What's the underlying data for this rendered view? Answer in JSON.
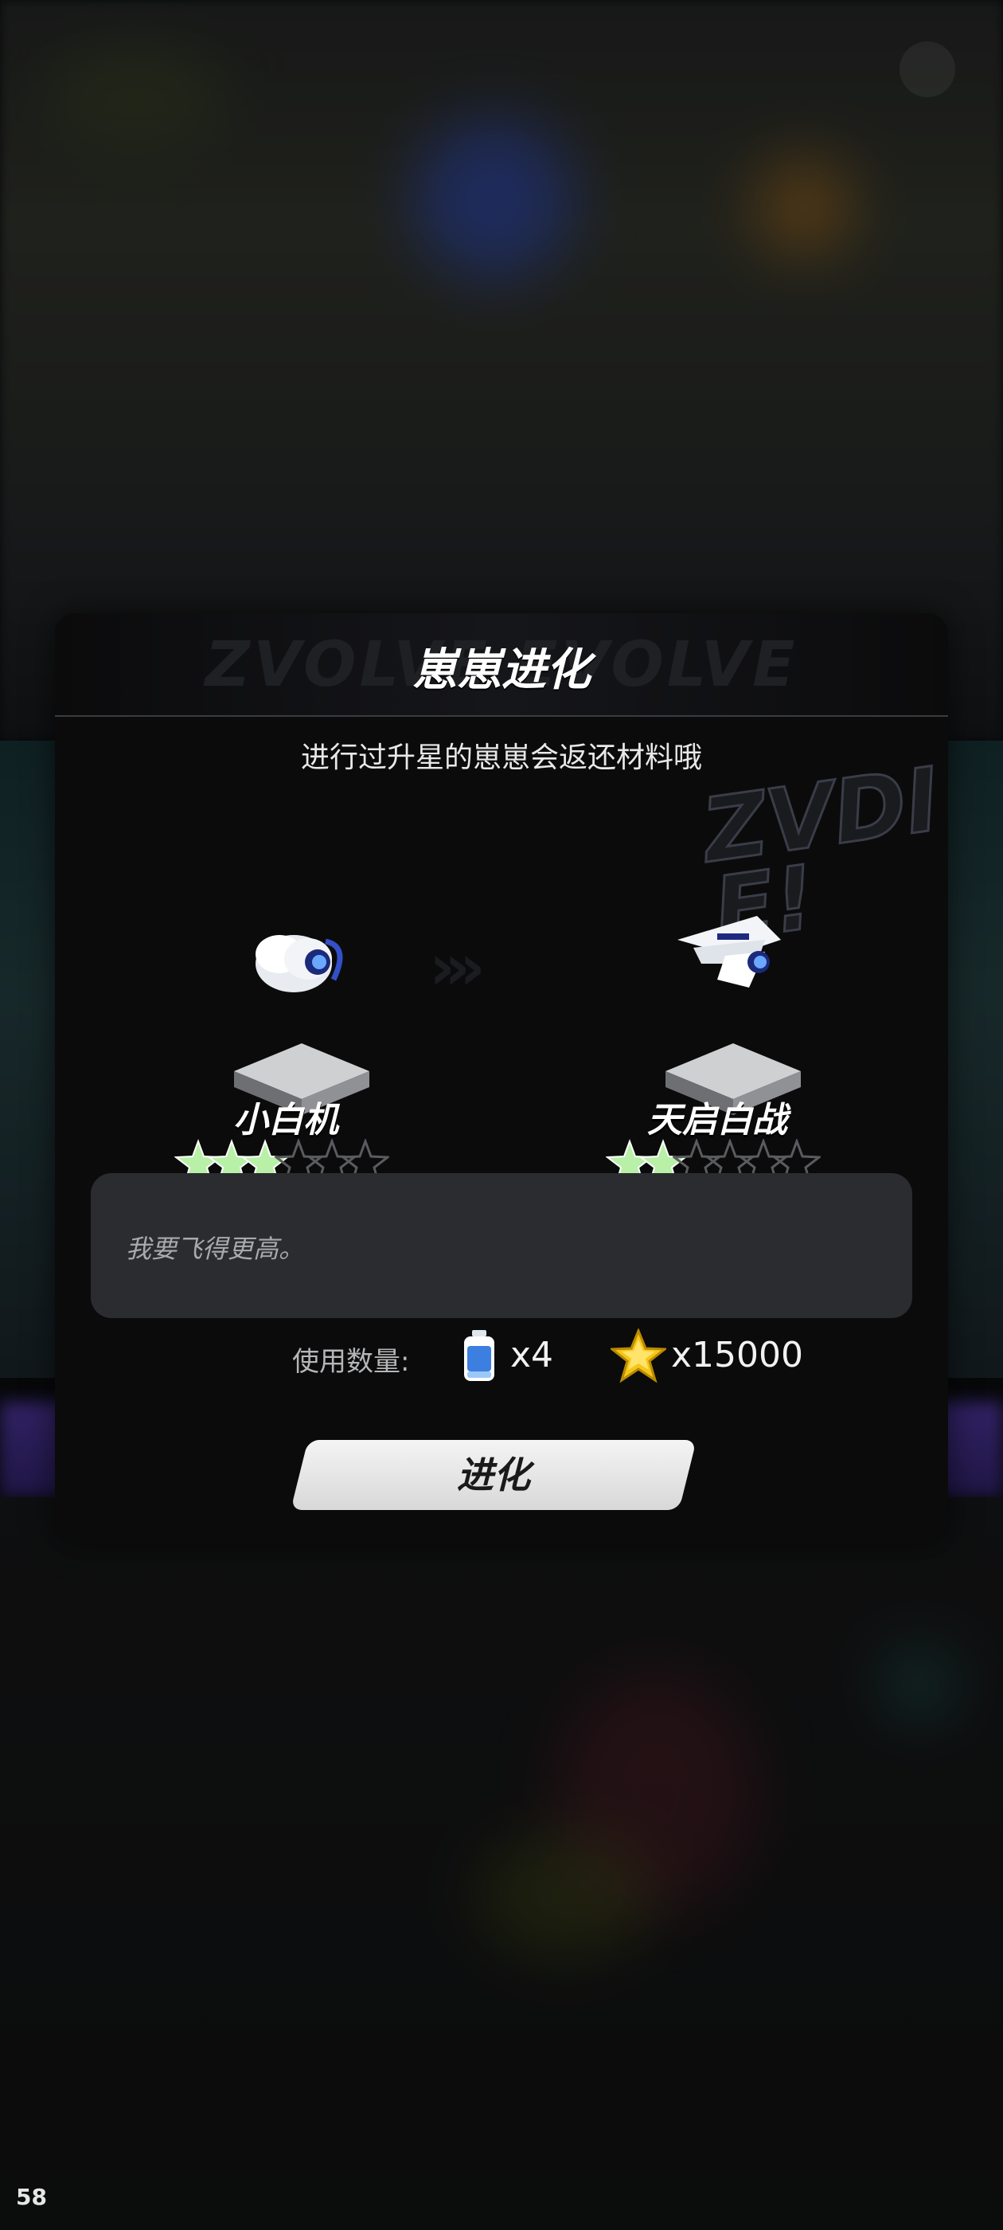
{
  "status": {
    "fps": "58"
  },
  "dialog": {
    "title": "崽崽进化",
    "graffiti": "ZVOLVE EVOLVE",
    "subtitle": "进行过升星的崽崽会返还材料哦",
    "current_pet": {
      "name": "小白机",
      "stars_filled": 3,
      "stars_total": 6,
      "icon": "white-drone-icon"
    },
    "target_pet": {
      "name": "天启白战",
      "stars_filled": 2,
      "stars_total": 6,
      "icon": "white-fighter-icon"
    },
    "description": "我要飞得更高。",
    "cost": {
      "label": "使用数量:",
      "bottle_count": "x4",
      "bottle_icon": "energy-bottle-icon",
      "coin_count": "x15000",
      "coin_icon": "gold-star-coin-icon"
    },
    "evolve_button": "进化"
  },
  "colors": {
    "dialog_bg": "#0b0b0c",
    "star_filled": "#b8f0a8",
    "star_empty": "#3a3b3e",
    "button": "#e8e8e8",
    "coin": "#f5c518"
  }
}
